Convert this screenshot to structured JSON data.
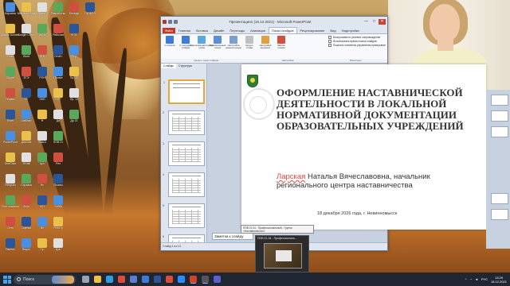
{
  "window": {
    "title": "Презентация1 (16.12.2021) - Microsoft PowerPoint",
    "minimize": "—",
    "maximize": "□",
    "close": "✕"
  },
  "ribbon": {
    "tabs": [
      "Файл",
      "Главная",
      "Вставка",
      "Дизайн",
      "Переходы",
      "Анимация",
      "Показ слайдов",
      "Рецензирование",
      "Вид",
      "Надстройки"
    ],
    "buttons": [
      {
        "label": "С начала",
        "color": "#3f7ad8"
      },
      {
        "label": "С текущего слайда",
        "color": "#3f7ad8"
      },
      {
        "label": "Широковещательный показ",
        "color": "#5aa8e0"
      },
      {
        "label": "Произвольный показ",
        "color": "#5a8fd8"
      },
      {
        "label": "Настройка демонстрации",
        "color": "#7a9fd0"
      },
      {
        "label": "Скрыть слайд",
        "color": "#c0c0c0"
      },
      {
        "label": "Настройка времени",
        "color": "#e0a040"
      },
      {
        "label": "Запись показа",
        "color": "#d05040"
      }
    ],
    "options": [
      "Воспроизвести речевое сопровождение",
      "Использовать время показа слайдов",
      "Показать элементы управления проигрывателя"
    ],
    "groups": [
      "Начать показ слайдов",
      "Настройка",
      "Мониторы"
    ]
  },
  "thumbs": {
    "tabs": [
      "Слайды",
      "Структура"
    ],
    "numbers": [
      "1",
      "2",
      "3",
      "4",
      "5",
      "6"
    ]
  },
  "slide": {
    "title": "ОФОРМЛЕНИЕ НАСТАВНИЧЕСКОЙ ДЕЯТЕЛЬНОСТИ В ЛОКАЛЬНОЙ НОРМАТИВНОЙ ДОКУМЕНТАЦИИ ОБРАЗОВАТЕЛЬНЫХ УЧРЕЖДЕНИЙ",
    "author_surname": "Ларская",
    "author_rest": " Наталья Вячеславовна, начальник регионального центра наставничества",
    "date": "18 декабря 2026 года, г. Невинномысск"
  },
  "notes_placeholder": "Заметки к слайду",
  "statusbar": "Слайд 1 из 14",
  "tooltip": "ПОВ 21-04 - Профессиональный - Группа «Наставничество»",
  "preview_title": "ПОВ 21-04 - Профессиональ...",
  "taskbar": {
    "search": "Поиск",
    "lang": "РУС",
    "time": "13:29",
    "date": "16.12.2021",
    "icons": [
      {
        "name": "task-view-icon",
        "color": "#9aa3b3"
      },
      {
        "name": "explorer-icon",
        "color": "#f0c040"
      },
      {
        "name": "edge-icon",
        "color": "#2f9fe0"
      },
      {
        "name": "chrome-icon",
        "color": "#e04a3a"
      },
      {
        "name": "store-icon",
        "color": "#5a7fd0"
      },
      {
        "name": "mail-icon",
        "color": "#3f7ad8"
      },
      {
        "name": "word-icon",
        "color": "#2a5699"
      },
      {
        "name": "yandex-icon",
        "color": "#e04a3a"
      },
      {
        "name": "zoom-icon",
        "color": "#2d8cff"
      },
      {
        "name": "powerpoint-icon",
        "color": "#d04423"
      },
      {
        "name": "camera-icon",
        "color": "#555"
      },
      {
        "name": "teams-icon",
        "color": "#5b5fc7"
      }
    ]
  },
  "desktop_icons": [
    [
      "Корзина",
      "Microsoft Edge",
      "Дипл",
      "Разработка",
      "Беседы",
      "Пр.ф 10"
    ],
    [
      "Adobe Acrobat",
      "Google Chrome",
      "WCN",
      "Рабочая",
      "Ф 11"
    ],
    [
      "Zoom",
      "Word",
      "ЛГБ",
      "Отчёт",
      "ОЦ2"
    ],
    [
      "Skype",
      "ЕГЭ",
      "РПН",
      "Проект",
      "Пр. 10"
    ],
    [
      "Яндекс",
      "1С",
      "ОКБ",
      "ВПР",
      "Пр. 12"
    ],
    [
      "Excel",
      "Шаблон",
      "Ф",
      "Дн",
      "Др 21"
    ],
    [
      "PowerPoint",
      "Диплом",
      "Книга",
      "ПОВ 21"
    ],
    [
      "OneDrive",
      "Устав",
      "Арх",
      "Рез"
    ],
    [
      "Telegram",
      "Справка",
      "Нп",
      "Планы"
    ],
    [
      "Этот компьютер",
      "Фото",
      "МО",
      "Учёба"
    ],
    [
      "Сеть",
      "Оценка",
      "Вн",
      "Реестр"
    ],
    [
      "Панель",
      "Видео",
      "Пр.",
      "Док"
    ]
  ]
}
